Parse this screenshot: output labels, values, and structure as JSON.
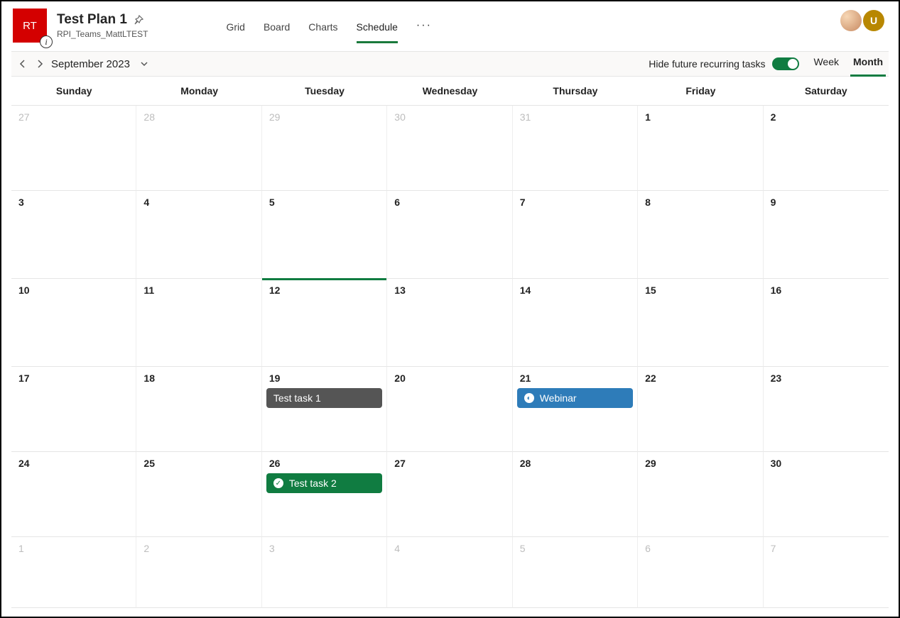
{
  "header": {
    "avatar_initials": "RT",
    "title": "Test Plan 1",
    "subtitle": "RPI_Teams_MattLTEST",
    "info_glyph": "i"
  },
  "tabs": {
    "items": [
      "Grid",
      "Board",
      "Charts",
      "Schedule"
    ],
    "active_index": 3,
    "more": "···"
  },
  "user_avatars": {
    "secondary_initial": "U"
  },
  "toolbar": {
    "month_label": "September 2023",
    "hide_label": "Hide future recurring tasks",
    "toggle_on": true,
    "view_week": "Week",
    "view_month": "Month",
    "active_view": "Month"
  },
  "weekdays": [
    "Sunday",
    "Monday",
    "Tuesday",
    "Wednesday",
    "Thursday",
    "Friday",
    "Saturday"
  ],
  "calendar": {
    "today": "12",
    "rows": [
      [
        {
          "n": "27",
          "muted": true
        },
        {
          "n": "28",
          "muted": true
        },
        {
          "n": "29",
          "muted": true
        },
        {
          "n": "30",
          "muted": true
        },
        {
          "n": "31",
          "muted": true
        },
        {
          "n": "1"
        },
        {
          "n": "2"
        }
      ],
      [
        {
          "n": "3"
        },
        {
          "n": "4"
        },
        {
          "n": "5"
        },
        {
          "n": "6"
        },
        {
          "n": "7"
        },
        {
          "n": "8"
        },
        {
          "n": "9"
        }
      ],
      [
        {
          "n": "10"
        },
        {
          "n": "11"
        },
        {
          "n": "12",
          "today": true
        },
        {
          "n": "13"
        },
        {
          "n": "14"
        },
        {
          "n": "15"
        },
        {
          "n": "16"
        }
      ],
      [
        {
          "n": "17"
        },
        {
          "n": "18"
        },
        {
          "n": "19",
          "task": {
            "label": "Test task 1",
            "color": "gray"
          }
        },
        {
          "n": "20"
        },
        {
          "n": "21",
          "task": {
            "label": "Webinar",
            "color": "blue",
            "icon": true
          }
        },
        {
          "n": "22"
        },
        {
          "n": "23"
        }
      ],
      [
        {
          "n": "24"
        },
        {
          "n": "25"
        },
        {
          "n": "26",
          "task": {
            "label": "Test task 2",
            "color": "green",
            "icon": true
          }
        },
        {
          "n": "27"
        },
        {
          "n": "28"
        },
        {
          "n": "29"
        },
        {
          "n": "30"
        }
      ],
      [
        {
          "n": "1",
          "muted": true
        },
        {
          "n": "2",
          "muted": true
        },
        {
          "n": "3",
          "muted": true
        },
        {
          "n": "4",
          "muted": true
        },
        {
          "n": "5",
          "muted": true
        },
        {
          "n": "6",
          "muted": true
        },
        {
          "n": "7",
          "muted": true
        }
      ]
    ]
  }
}
